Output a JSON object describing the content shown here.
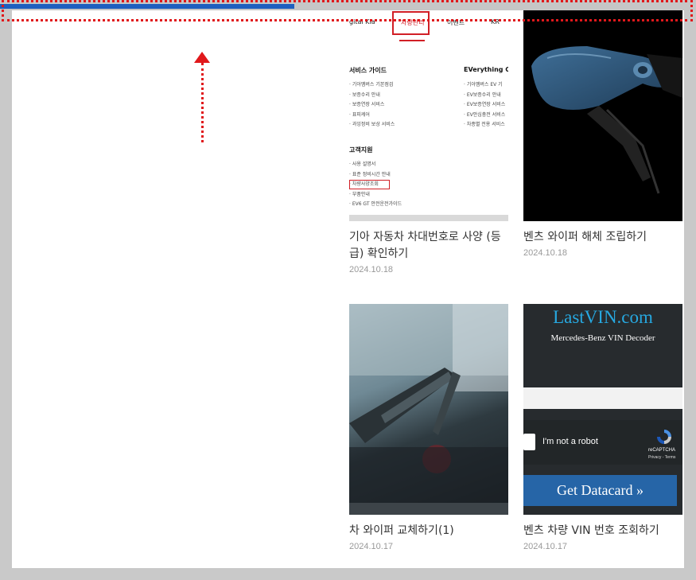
{
  "reading_progress": 0.423,
  "colors": {
    "accent": "#1e5fbf",
    "highlight": "#e0181b"
  },
  "posts": [
    {
      "title": "기아 자동차 차대번호로 사양 (등급) 확인하기",
      "date": "2024.10.18",
      "thumb": {
        "nav": [
          "gital Kia",
          "차량관리",
          "이벤트",
          "KR"
        ],
        "col1_title": "서비스 가이드",
        "col1_items": [
          "· 기아멤버스 기본점검",
          "· 보증수리 안내",
          "· 보증연장 서비스",
          "· 표피케어",
          "· 과잉정비 보상 서비스"
        ],
        "col2_title": "EVerything Ca",
        "col2_items": [
          "· 기아멤버스 EV 기",
          "· EV보증수리 안내",
          "· EV보증연장 서비스",
          "· EV안심충전 서비스",
          "· 차종별 전용 서비스"
        ],
        "col3_title": "고객지원",
        "col3_items": [
          "· 사용 설명서",
          "· 표준 정비시간 안내",
          "· 차량사양조회",
          "· 부품안내",
          "· EV6 GT 안전운전가이드"
        ]
      }
    },
    {
      "title": "벤츠 와이퍼 해체 조립하기",
      "date": "2024.10.18"
    },
    {
      "title": "차 와이퍼 교체하기(1)",
      "date": "2024.10.17"
    },
    {
      "title": "벤츠 차량 VIN 번호 조회하기",
      "date": "2024.10.17",
      "thumb": {
        "site_title": "LastVIN.com",
        "site_subtitle": "Mercedes-Benz VIN Decoder",
        "captcha_label": "I'm not a robot",
        "recaptcha": "reCAPTCHA",
        "privacy": "Privacy - Terms",
        "button_label": "Get Datacard »"
      }
    }
  ]
}
